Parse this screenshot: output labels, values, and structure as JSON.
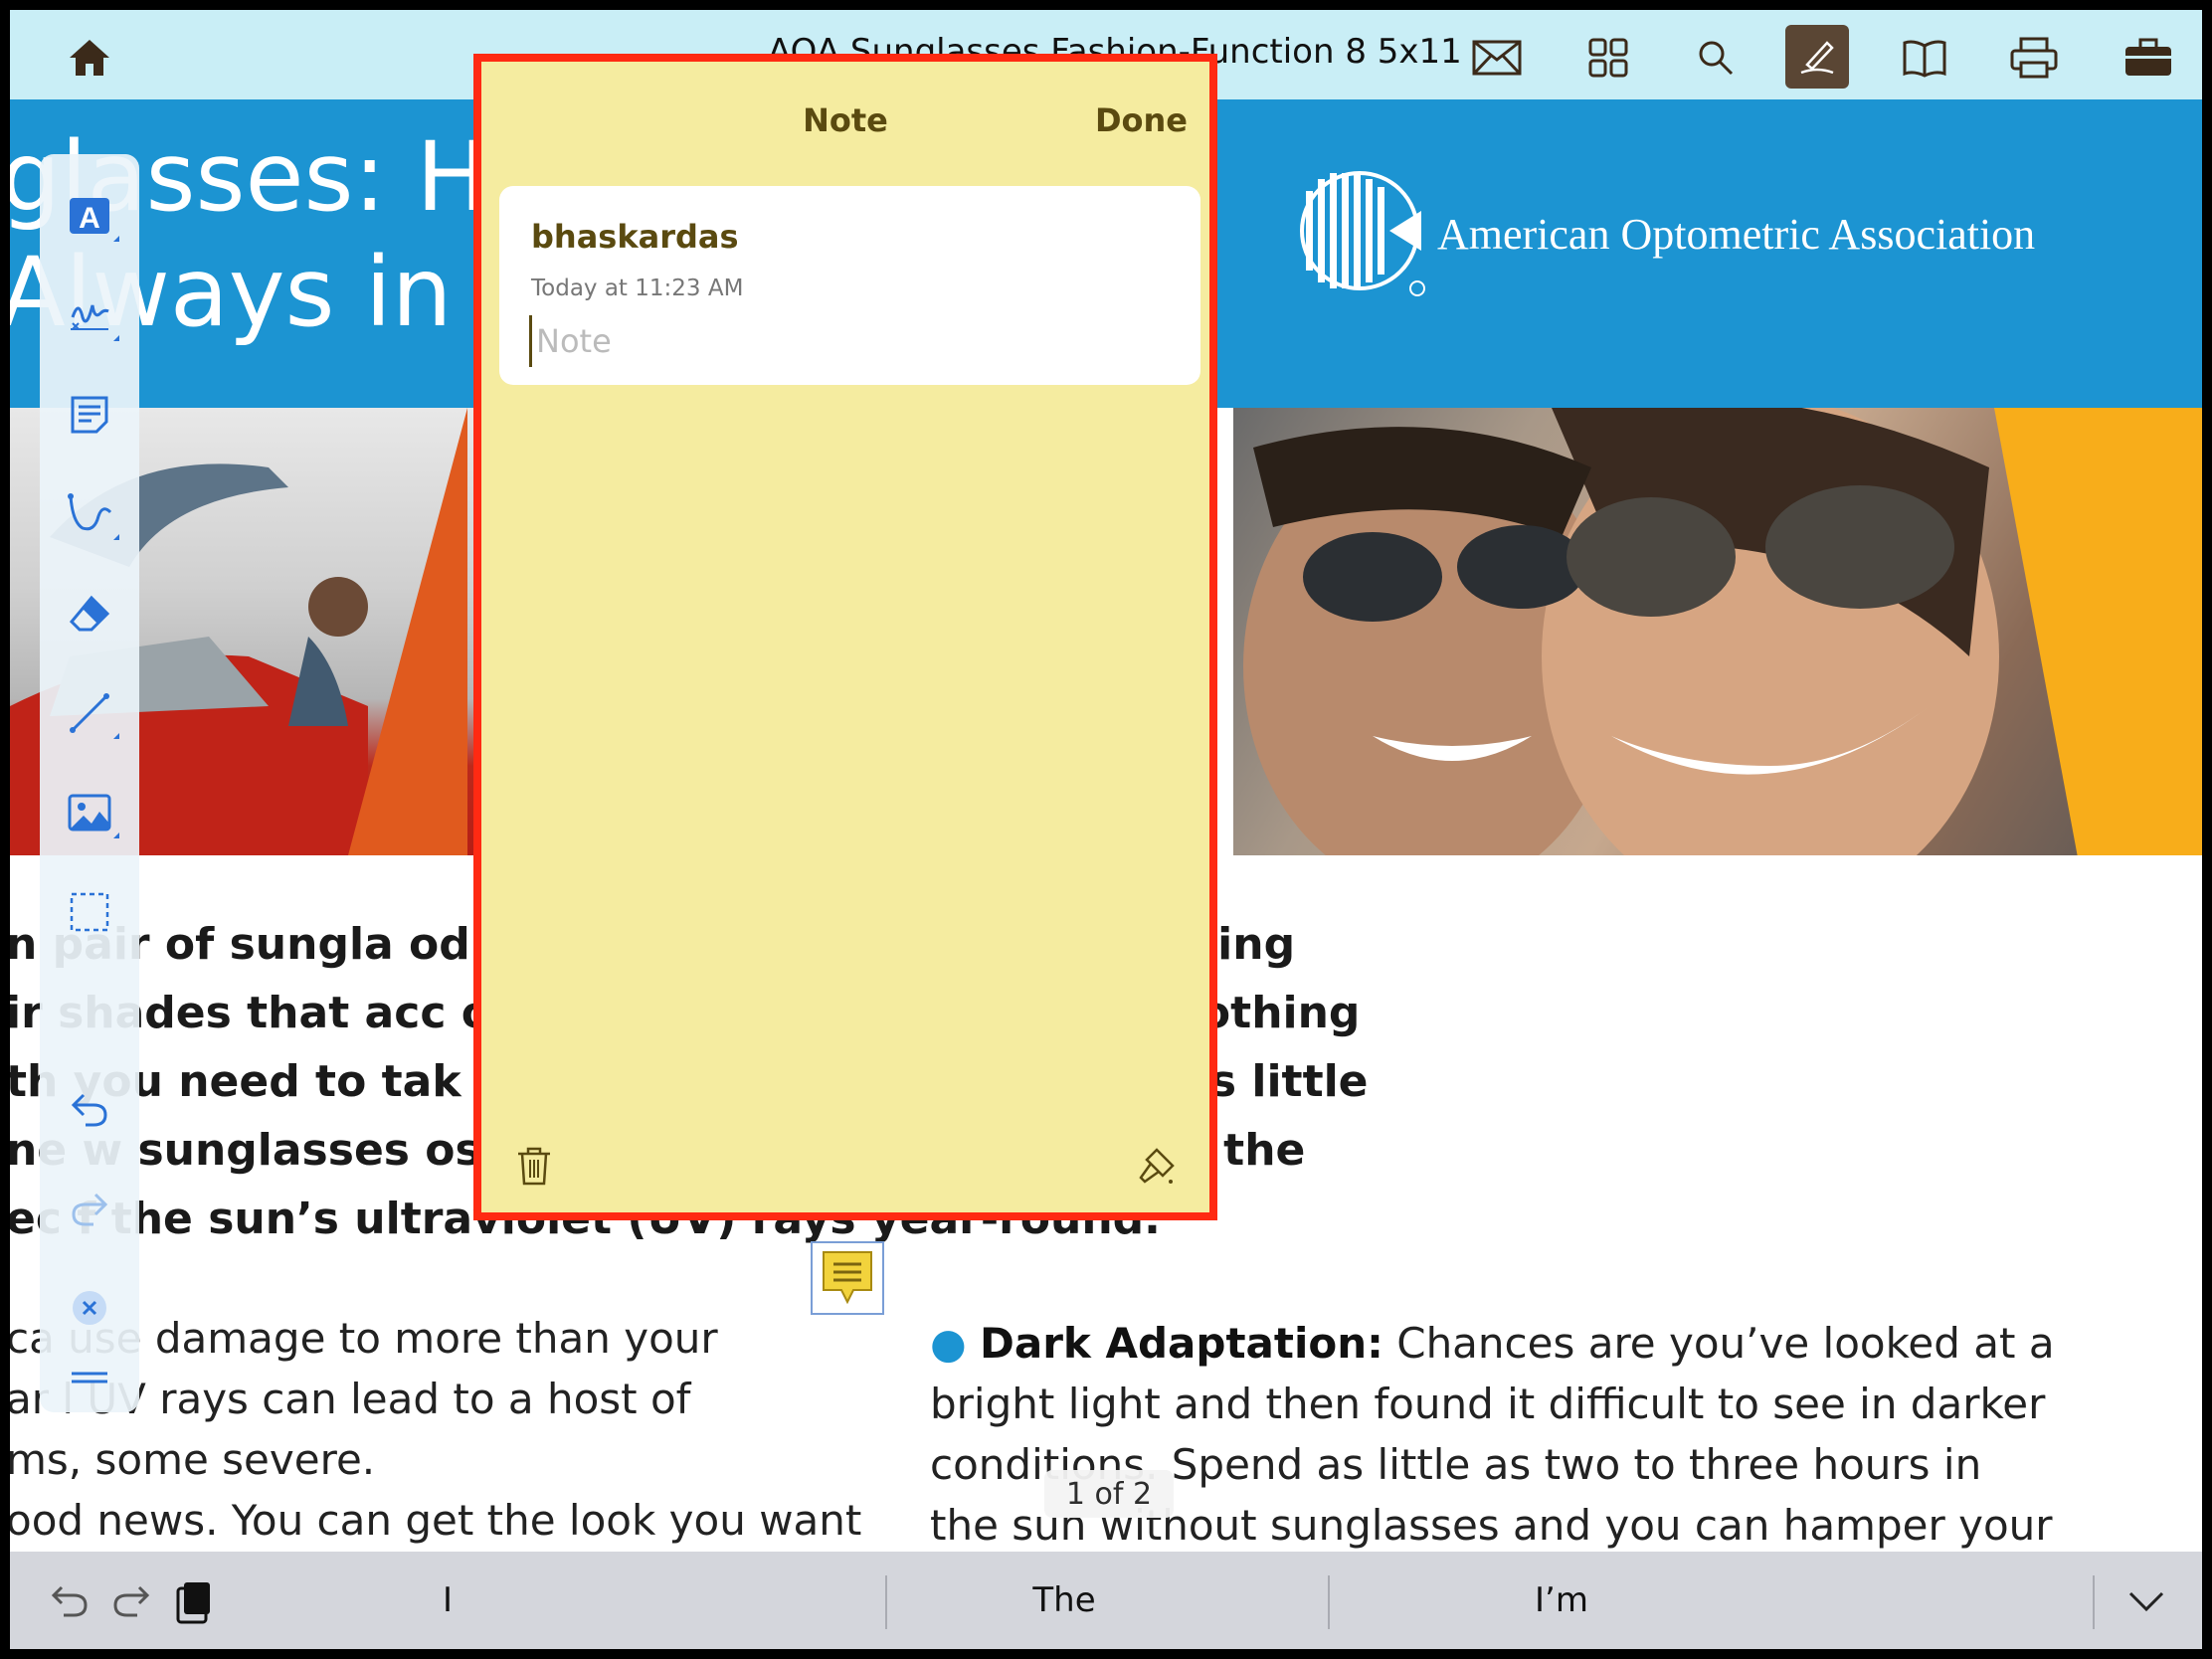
{
  "topbar": {
    "title": "AOA Sunglasses Fashion-Function 8 5x11",
    "icons": [
      "home-icon",
      "mail-icon",
      "thumbnails-icon",
      "search-icon",
      "annotate-icon",
      "bookmarks-icon",
      "print-icon",
      "briefcase-icon"
    ],
    "accent": "#5a4634"
  },
  "document": {
    "headline_line1": "glasses: H",
    "headline_line2": "Always in",
    "org_name": "American Optometric Association",
    "lead_lines": [
      "  n    pair of sungla                       od chance that you want something",
      "ir    shades that acc                       on statement. While there’s nothing",
      "th    you need to tak                       uying. After all, fashion means little",
      "ne    w sunglasses                          ose – protecting your eyes from the",
      "ec    f the sun’s ultraviolet (UV) rays year-round."
    ],
    "body_left": [
      "ca     use damage to more than your",
      "ar     l UV rays can lead to a host of",
      "ms, some severe.",
      "ood news. You can get the look you want"
    ],
    "bullet_term": "Dark Adaptation:",
    "bullet_first": " Chances are you’ve looked at a",
    "body_right": [
      "bright light and then found it difficult to see in darker",
      "conditions. Spend as little as two to three hours in",
      "the sun without sunglasses and you can hamper your"
    ],
    "page_indicator": "1 of 2",
    "brand_blue": "#1c94d2"
  },
  "annotation_toolbar": {
    "tools": [
      "text-icon",
      "signature-icon",
      "note-icon",
      "freehand-icon",
      "eraser-icon",
      "line-icon",
      "image-icon",
      "selection-icon",
      "undo-icon",
      "redo-icon",
      "close-icon",
      "handle-icon"
    ]
  },
  "note": {
    "title": "Note",
    "done_label": "Done",
    "author": "bhaskardas",
    "timestamp": "Today at 11:23 AM",
    "placeholder": "Note",
    "value": "",
    "background": "#f5eca0",
    "highlight_border": "#ff2a12"
  },
  "keyboard": {
    "suggestions": [
      "I",
      "The",
      "I’m"
    ]
  }
}
